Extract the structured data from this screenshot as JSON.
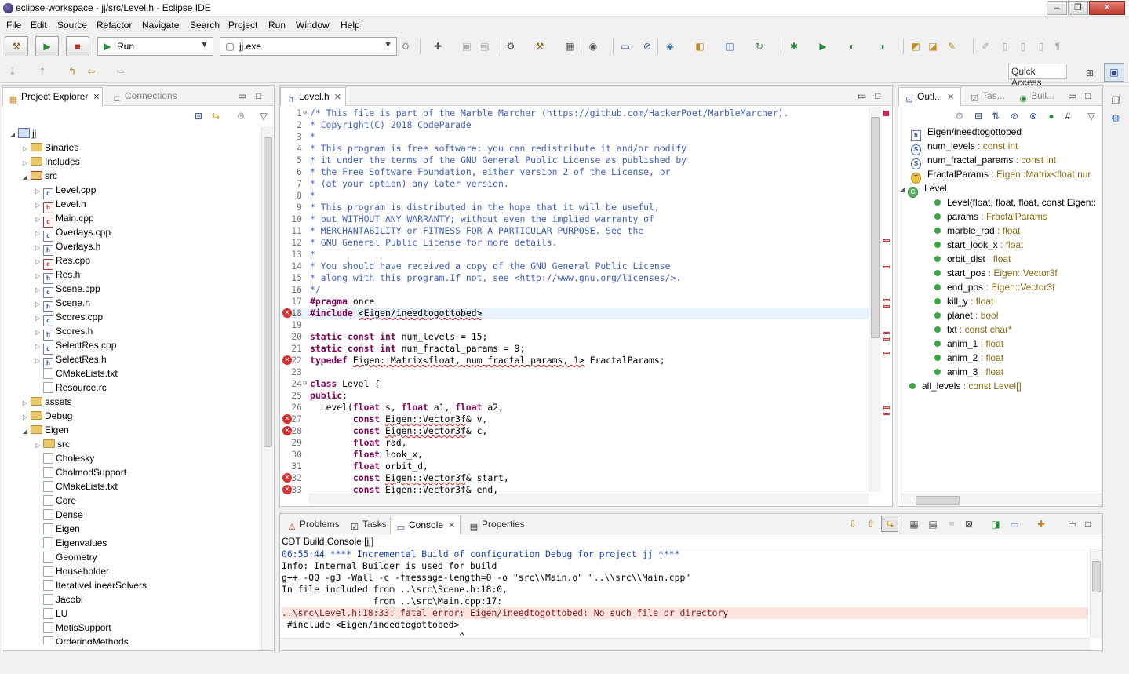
{
  "window": {
    "title": "eclipse-workspace - jj/src/Level.h - Eclipse IDE",
    "minimize": "–",
    "maximize": "❐",
    "close": "✕"
  },
  "menu": [
    "File",
    "Edit",
    "Source",
    "Refactor",
    "Navigate",
    "Search",
    "Project",
    "Run",
    "Window",
    "Help"
  ],
  "toolbar": {
    "launch_mode": "Run",
    "launch_target": "jj.exe",
    "quick_access": "Quick Access"
  },
  "project_explorer": {
    "tabs": [
      "Project Explorer",
      "Connections"
    ],
    "items": [
      {
        "label": "jj",
        "depth": 0,
        "kind": "project",
        "expanded": true
      },
      {
        "label": "Binaries",
        "depth": 1,
        "kind": "folder",
        "expanded": false
      },
      {
        "label": "Includes",
        "depth": 1,
        "kind": "folder",
        "expanded": false
      },
      {
        "label": "src",
        "depth": 1,
        "kind": "errfolder",
        "expanded": true
      },
      {
        "label": "Level.cpp",
        "depth": 2,
        "kind": "cpp",
        "expanded": false
      },
      {
        "label": "Level.h",
        "depth": 2,
        "kind": "herr",
        "expanded": false
      },
      {
        "label": "Main.cpp",
        "depth": 2,
        "kind": "cpperr",
        "expanded": false
      },
      {
        "label": "Overlays.cpp",
        "depth": 2,
        "kind": "cpp",
        "expanded": false
      },
      {
        "label": "Overlays.h",
        "depth": 2,
        "kind": "h",
        "expanded": false
      },
      {
        "label": "Res.cpp",
        "depth": 2,
        "kind": "cpperr",
        "expanded": false
      },
      {
        "label": "Res.h",
        "depth": 2,
        "kind": "h",
        "expanded": false
      },
      {
        "label": "Scene.cpp",
        "depth": 2,
        "kind": "cpp",
        "expanded": false
      },
      {
        "label": "Scene.h",
        "depth": 2,
        "kind": "h",
        "expanded": false
      },
      {
        "label": "Scores.cpp",
        "depth": 2,
        "kind": "cpp",
        "expanded": false
      },
      {
        "label": "Scores.h",
        "depth": 2,
        "kind": "h",
        "expanded": false
      },
      {
        "label": "SelectRes.cpp",
        "depth": 2,
        "kind": "cpp",
        "expanded": false
      },
      {
        "label": "SelectRes.h",
        "depth": 2,
        "kind": "h",
        "expanded": false
      },
      {
        "label": "CMakeLists.txt",
        "depth": 2,
        "kind": "plain",
        "leaf": true
      },
      {
        "label": "Resource.rc",
        "depth": 2,
        "kind": "plain",
        "leaf": true
      },
      {
        "label": "assets",
        "depth": 1,
        "kind": "folder",
        "expanded": false
      },
      {
        "label": "Debug",
        "depth": 1,
        "kind": "folder",
        "expanded": false
      },
      {
        "label": "Eigen",
        "depth": 1,
        "kind": "folder",
        "expanded": true
      },
      {
        "label": "src",
        "depth": 2,
        "kind": "folder",
        "expanded": false
      },
      {
        "label": "Cholesky",
        "depth": 2,
        "kind": "plain",
        "leaf": true
      },
      {
        "label": "CholmodSupport",
        "depth": 2,
        "kind": "plain",
        "leaf": true
      },
      {
        "label": "CMakeLists.txt",
        "depth": 2,
        "kind": "plain",
        "leaf": true
      },
      {
        "label": "Core",
        "depth": 2,
        "kind": "plain",
        "leaf": true
      },
      {
        "label": "Dense",
        "depth": 2,
        "kind": "plain",
        "leaf": true
      },
      {
        "label": "Eigen",
        "depth": 2,
        "kind": "plain",
        "leaf": true
      },
      {
        "label": "Eigenvalues",
        "depth": 2,
        "kind": "plain",
        "leaf": true
      },
      {
        "label": "Geometry",
        "depth": 2,
        "kind": "plain",
        "leaf": true
      },
      {
        "label": "Householder",
        "depth": 2,
        "kind": "plain",
        "leaf": true
      },
      {
        "label": "IterativeLinearSolvers",
        "depth": 2,
        "kind": "plain",
        "leaf": true
      },
      {
        "label": "Jacobi",
        "depth": 2,
        "kind": "plain",
        "leaf": true
      },
      {
        "label": "LU",
        "depth": 2,
        "kind": "plain",
        "leaf": true
      },
      {
        "label": "MetisSupport",
        "depth": 2,
        "kind": "plain",
        "leaf": true
      },
      {
        "label": "OrderingMethods",
        "depth": 2,
        "kind": "plain",
        "leaf": true
      }
    ]
  },
  "editor": {
    "tab": "Level.h",
    "lines": [
      {
        "n": "1",
        "t": "/* This file is part of the Marble Marcher (https://github.com/HackerPoet/MarbleMarcher).",
        "c": "comment",
        "fold": true
      },
      {
        "n": "2",
        "t": "* Copyright(C) 2018 CodeParade",
        "c": "comment"
      },
      {
        "n": "3",
        "t": "*",
        "c": "comment"
      },
      {
        "n": "4",
        "t": "* This program is free software: you can redistribute it and/or modify",
        "c": "comment"
      },
      {
        "n": "5",
        "t": "* it under the terms of the GNU General Public License as published by",
        "c": "comment"
      },
      {
        "n": "6",
        "t": "* the Free Software Foundation, either version 2 of the License, or",
        "c": "comment"
      },
      {
        "n": "7",
        "t": "* (at your option) any later version.",
        "c": "comment"
      },
      {
        "n": "8",
        "t": "*",
        "c": "comment"
      },
      {
        "n": "9",
        "t": "* This program is distributed in the hope that it will be useful,",
        "c": "comment"
      },
      {
        "n": "10",
        "t": "* but WITHOUT ANY WARRANTY; without even the implied warranty of",
        "c": "comment"
      },
      {
        "n": "11",
        "t": "* MERCHANTABILITY or FITNESS FOR A PARTICULAR PURPOSE. See the",
        "c": "comment"
      },
      {
        "n": "12",
        "t": "* GNU General Public License for more details.",
        "c": "comment"
      },
      {
        "n": "13",
        "t": "*",
        "c": "comment"
      },
      {
        "n": "14",
        "t": "* You should have received a copy of the GNU General Public License",
        "c": "comment"
      },
      {
        "n": "15",
        "t": "* along with this program.If not, see <http://www.gnu.org/licenses/>.",
        "c": "comment"
      },
      {
        "n": "16",
        "t": "*/",
        "c": "comment"
      },
      {
        "n": "17",
        "kw": "#pragma",
        "t": " once"
      },
      {
        "n": "18",
        "kw": "#include",
        "t": " ",
        "sq": "<Eigen/ineedtogottobed>",
        "err": true,
        "hl": true
      },
      {
        "n": "19",
        "t": ""
      },
      {
        "n": "20",
        "kw": "static const int",
        "t": " num_levels = 15;"
      },
      {
        "n": "21",
        "kw": "static const int",
        "t": " num_fractal_params = 9;"
      },
      {
        "n": "22",
        "kw": "typedef",
        "t": " ",
        "sq": "Eigen::Matrix<float, num_fractal_params, 1>",
        "t2": " FractalParams;",
        "err": true
      },
      {
        "n": "23",
        "t": ""
      },
      {
        "n": "24",
        "kw": "class",
        "t": " Level {",
        "fold": true
      },
      {
        "n": "25",
        "kw": "public",
        "t": ":"
      },
      {
        "n": "26",
        "t": "  Level(",
        "kw2": "float",
        "t2": " s, ",
        "kw3": "float",
        "t3": " a1, ",
        "kw4": "float",
        "t4": " a2,"
      },
      {
        "n": "27",
        "pre": "        ",
        "kw": "const",
        "t": " ",
        "sq": "Eigen::Vector3f",
        "t2": "& v,",
        "err": true
      },
      {
        "n": "28",
        "pre": "        ",
        "kw": "const",
        "t": " ",
        "sq": "Eigen::Vector3f",
        "t2": "& c,",
        "err": true
      },
      {
        "n": "29",
        "pre": "        ",
        "kw": "float",
        "t": " rad,"
      },
      {
        "n": "30",
        "pre": "        ",
        "kw": "float",
        "t": " look_x,"
      },
      {
        "n": "31",
        "pre": "        ",
        "kw": "float",
        "t": " orbit_d,"
      },
      {
        "n": "32",
        "pre": "        ",
        "kw": "const",
        "t": " ",
        "sq": "Eigen::Vector3f",
        "t2": "& start,",
        "err": true
      },
      {
        "n": "33",
        "pre": "        ",
        "kw": "const",
        "t": " ",
        "sq": "Eigen::Vector3f",
        "t2": "& end,",
        "err": true
      }
    ]
  },
  "outline": {
    "tabs": [
      "Outl...",
      "Tas...",
      "Buil..."
    ],
    "items": [
      {
        "name": "Eigen/ineedtogottobed",
        "type": "",
        "depth": 0,
        "icon": "include"
      },
      {
        "name": "num_levels",
        "type": " : const int",
        "depth": 0,
        "icon": "static"
      },
      {
        "name": "num_fractal_params",
        "type": " : const int",
        "depth": 0,
        "icon": "static"
      },
      {
        "name": "FractalParams",
        "type": " : Eigen::Matrix<float,nur",
        "depth": 0,
        "icon": "typedef"
      },
      {
        "name": "Level",
        "type": "",
        "depth": 0,
        "icon": "class",
        "expanded": true
      },
      {
        "name": "Level(float, float, float, const Eigen::",
        "type": "",
        "depth": 1,
        "icon": "dot"
      },
      {
        "name": "params",
        "type": " : FractalParams",
        "depth": 1,
        "icon": "dot"
      },
      {
        "name": "marble_rad",
        "type": " : float",
        "depth": 1,
        "icon": "dot"
      },
      {
        "name": "start_look_x",
        "type": " : float",
        "depth": 1,
        "icon": "dot"
      },
      {
        "name": "orbit_dist",
        "type": " : float",
        "depth": 1,
        "icon": "dot"
      },
      {
        "name": "start_pos",
        "type": " : Eigen::Vector3f",
        "depth": 1,
        "icon": "dot"
      },
      {
        "name": "end_pos",
        "type": " : Eigen::Vector3f",
        "depth": 1,
        "icon": "dot"
      },
      {
        "name": "kill_y",
        "type": " : float",
        "depth": 1,
        "icon": "dot"
      },
      {
        "name": "planet",
        "type": " : bool",
        "depth": 1,
        "icon": "dot"
      },
      {
        "name": "txt",
        "type": " : const char*",
        "depth": 1,
        "icon": "dotc"
      },
      {
        "name": "anim_1",
        "type": " : float",
        "depth": 1,
        "icon": "dot"
      },
      {
        "name": "anim_2",
        "type": " : float",
        "depth": 1,
        "icon": "dot"
      },
      {
        "name": "anim_3",
        "type": " : float",
        "depth": 1,
        "icon": "dot"
      },
      {
        "name": "all_levels",
        "type": " : const Level[]",
        "depth": 0,
        "icon": "dotc"
      }
    ]
  },
  "bottom": {
    "tabs": [
      "Problems",
      "Tasks",
      "Console",
      "Properties"
    ],
    "console_title": "CDT Build Console [jj]",
    "lines": [
      {
        "t": "06:55:44 **** Incremental Build of configuration Debug for project jj ****",
        "c": "blue"
      },
      {
        "t": "Info: Internal Builder is used for build",
        "c": ""
      },
      {
        "t": "g++ -O0 -g3 -Wall -c -fmessage-length=0 -o \"src\\\\Main.o\" \"..\\\\src\\\\Main.cpp\"",
        "c": ""
      },
      {
        "t": "In file included from ..\\src\\Scene.h:18:0,",
        "c": ""
      },
      {
        "t": "                 from ..\\src\\Main.cpp:17:",
        "c": ""
      },
      {
        "t": "..\\src\\Level.h:18:33: fatal error: Eigen/ineedtogottobed: No such file or directory",
        "c": "err"
      },
      {
        "t": " #include <Eigen/ineedtogottobed>",
        "c": ""
      },
      {
        "t": "                                 ^",
        "c": ""
      }
    ]
  }
}
